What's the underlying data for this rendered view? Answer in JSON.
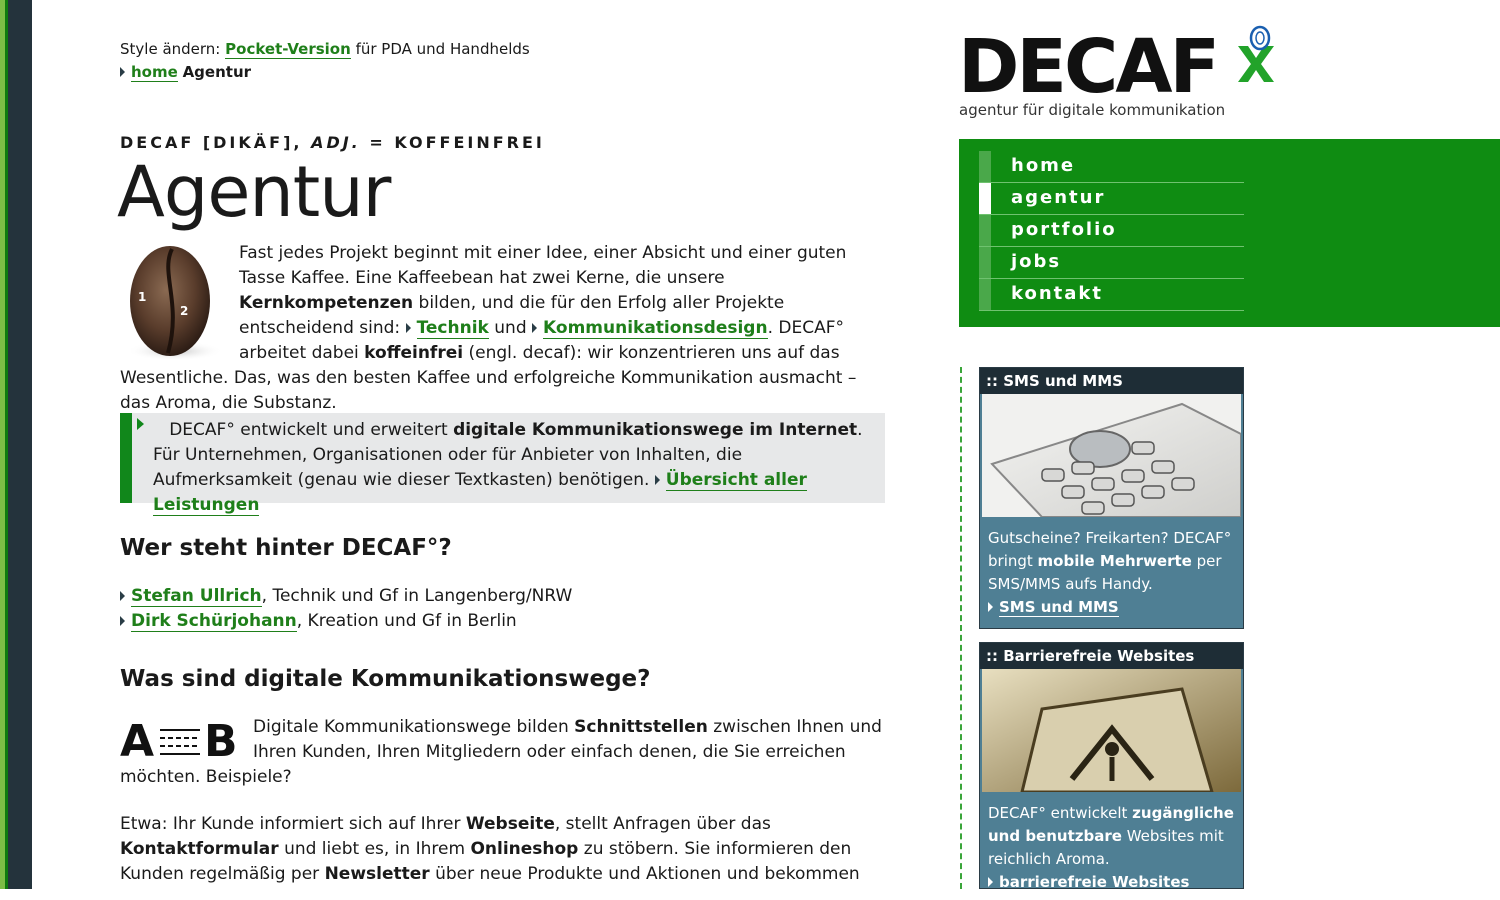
{
  "style_switch": {
    "prefix": "Style ändern:",
    "link": "Pocket-Version",
    "suffix": "für PDA und Handhelds"
  },
  "breadcrumb": {
    "home": "home",
    "current": "Agentur"
  },
  "kicker": {
    "part1": "DECAF [DIKÄF],",
    "adj": "ADJ.",
    "part2": "= KOFFEINFREI"
  },
  "page_title": "Agentur",
  "intro": {
    "t1": "Fast jedes Projekt beginnt mit einer Idee, einer Absicht und einer guten Tasse Kaffee. Eine Kaffeebean hat zwei Kerne, die unsere",
    "b1": "Kernkompetenzen",
    "t2": "bilden, und die für den Erfolg aller Projekte entscheidend sind:",
    "link1": "Technik",
    "t3": "und",
    "link2": "Kommunikationsdesign",
    "t4": ". DECAF° arbeitet dabei",
    "b2": "koffeinfrei",
    "t5": "(engl. decaf): wir konzentrieren uns auf das Wesentliche. Das, was den besten Kaffee und erfolgreiche Kommunikation ausmacht – das Aroma, die Substanz.",
    "bean_labels": [
      "1",
      "2"
    ]
  },
  "callout": {
    "t1": "DECAF° entwickelt und erweitert",
    "b1": "digitale Kommunikationswege im Internet",
    "t2": ". Für Unternehmen, Organisationen oder für Anbieter von Inhalten, die Aufmerksamkeit (genau wie dieser Textkasten) benötigen.",
    "link": "Übersicht aller Leistungen"
  },
  "who": {
    "heading": "Wer steht hinter DECAF°?",
    "people": [
      {
        "name": "Stefan Ullrich",
        "role": ", Technik und Gf in Langenberg/NRW"
      },
      {
        "name": "Dirk Schürjohann",
        "role": ", Kreation und Gf in Berlin"
      }
    ]
  },
  "what": {
    "heading": "Was sind digitale Kommunikationswege?",
    "ab_left": "A",
    "ab_right": "B",
    "t1": "Digitale Kommunikationswege bilden",
    "b1": "Schnittstellen",
    "t2": "zwischen Ihnen und Ihren Kunden, Ihren Mitgliedern oder einfach denen, die Sie erreichen möchten. Beispiele?",
    "p3_t1": "Etwa: Ihr Kunde informiert sich auf Ihrer",
    "p3_b1": "Webseite",
    "p3_t2": ", stellt Anfragen über das",
    "p3_b2": "Kontaktformular",
    "p3_t3": "und liebt es, in Ihrem",
    "p3_b3": "Onlineshop",
    "p3_t4": "zu stöbern. Sie informieren den Kunden regelmäßig per",
    "p3_b4": "Newsletter",
    "p3_t5": "über neue Produkte und Aktionen und bekommen"
  },
  "logo": {
    "word": "DECAF",
    "tagline": "agentur für digitale kommunikation"
  },
  "nav": {
    "items": [
      "home",
      "agentur",
      "portfolio",
      "jobs",
      "kontakt"
    ],
    "active": "agentur"
  },
  "sidebar": {
    "box1": {
      "title": ":: SMS und MMS",
      "t1": "Gutscheine? Freikarten? DECAF° bringt",
      "b1": "mobile Mehrwerte",
      "t2": "per SMS/MMS aufs Handy.",
      "link": "SMS und MMS"
    },
    "box2": {
      "title": ":: Barrierefreie Websites",
      "t1": "DECAF° entwickelt",
      "b1": "zugängliche und benutzbare",
      "t2": "Websites mit reichlich Aroma.",
      "link": "barrierefreie Websites"
    }
  },
  "colors": {
    "brand_green": "#0f8c12",
    "link_green": "#1f7f1a",
    "dark": "#24333c",
    "box_blue": "#4f7f94"
  }
}
